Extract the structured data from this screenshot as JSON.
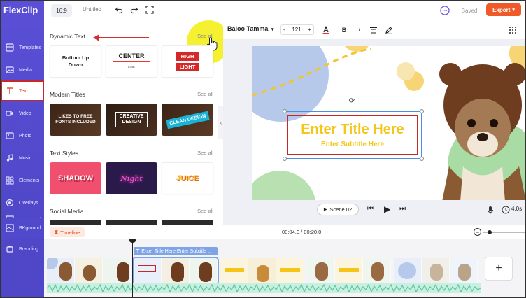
{
  "app": {
    "logo_text": "FlexClip"
  },
  "sidebar": {
    "items": [
      {
        "label": "Templates",
        "icon": "layout-icon"
      },
      {
        "label": "Media",
        "icon": "image-folder-icon"
      },
      {
        "label": "Text",
        "icon": "text-t-icon",
        "active": true
      },
      {
        "label": "Video",
        "icon": "video-icon"
      },
      {
        "label": "Photo",
        "icon": "photo-icon"
      },
      {
        "label": "Music",
        "icon": "music-note-icon"
      },
      {
        "label": "Elements",
        "icon": "shapes-icon"
      },
      {
        "label": "Overlays",
        "icon": "layers-icon"
      },
      {
        "label": "BKground",
        "icon": "background-icon"
      },
      {
        "label": "Branding",
        "icon": "brand-icon"
      }
    ]
  },
  "topbar": {
    "ratio": "16:9",
    "title": "Untitled",
    "saved_label": "Saved",
    "export_label": "Export"
  },
  "panel": {
    "sections": [
      {
        "title": "Dynamic Text",
        "see_all": "See all",
        "tiles": [
          {
            "line1": "Bottom Up",
            "line2": "Down"
          },
          {
            "line1": "CENTER",
            "line2": "LINE"
          },
          {
            "line1": "HIGH",
            "line2": "LIGHT"
          }
        ]
      },
      {
        "title": "Modern Titles",
        "see_all": "See all",
        "tiles": [
          {
            "line1": "LIKES TO FREE",
            "line2": "FONTS INCLUDED"
          },
          {
            "line1": "CREATIVE",
            "line2": "DESIGN"
          },
          {
            "line1": "CLEAN DESIGN",
            "line2": ""
          }
        ]
      },
      {
        "title": "Text Styles",
        "see_all": "See all",
        "tiles": [
          {
            "line1": "SHADOW"
          },
          {
            "line1": "Night"
          },
          {
            "line1": "JUICE"
          }
        ]
      },
      {
        "title": "Social Media",
        "see_all": "See all"
      }
    ]
  },
  "fontbar": {
    "font_name": "Baloo Tamma",
    "font_size": "121",
    "minus": "-",
    "plus": "+"
  },
  "canvas": {
    "title": "Enter Title Here",
    "subtitle": "Enter Subtitle Here"
  },
  "player": {
    "scene_label": "Scene 02",
    "duration": "4.0s"
  },
  "timeline": {
    "label": "Timeline",
    "time": "00:04.0 / 00:20.0",
    "text_track": "Enter Title Here,Enter Subtitle ..."
  },
  "colors": {
    "sidebar": "#5a4fd6",
    "accent": "#f05a28",
    "title_yellow": "#f5c518",
    "highlight_red": "#c62828"
  }
}
